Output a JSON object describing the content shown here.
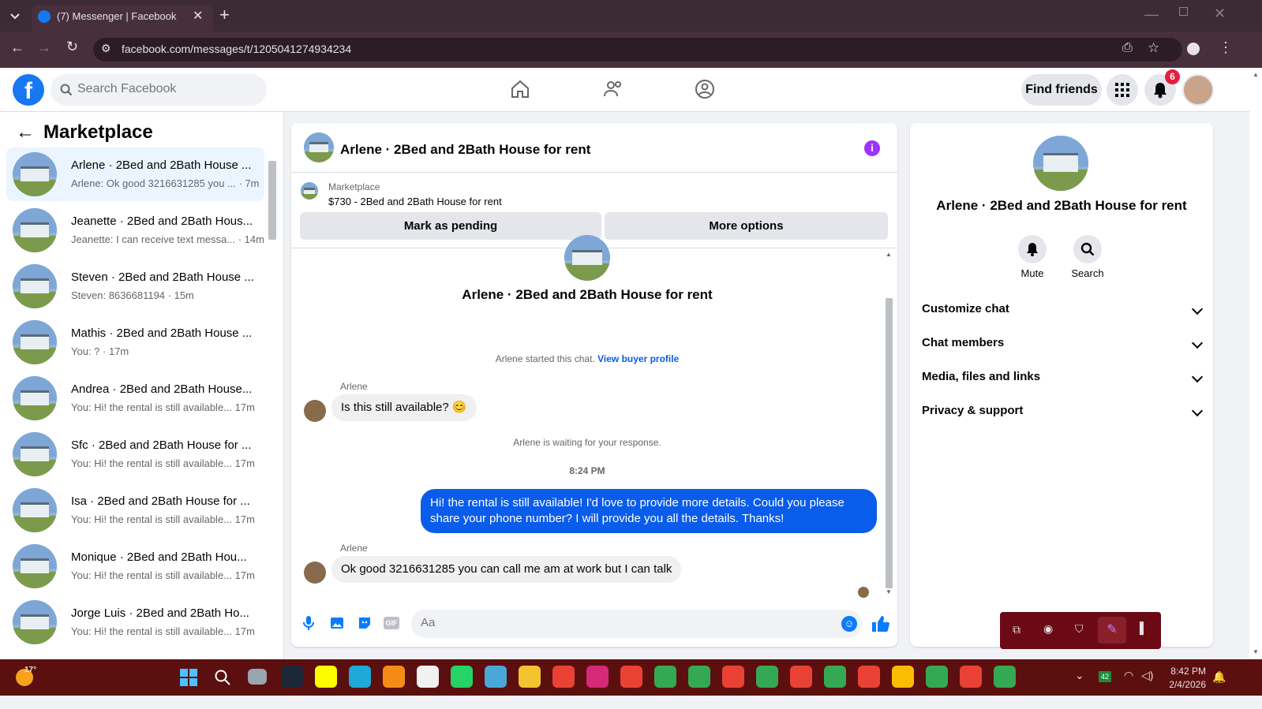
{
  "browser": {
    "tab_title": "(7) Messenger | Facebook",
    "url": "facebook.com/messages/t/1205041274934234"
  },
  "header": {
    "search_placeholder": "Search Facebook",
    "find_friends": "Find friends",
    "notification_count": "6"
  },
  "sidebar": {
    "title": "Marketplace",
    "conversations": [
      {
        "title": "Arlene · 2Bed and 2Bath House ...",
        "preview": "Arlene: Ok good 3216631285 you ...",
        "time": "· 7m"
      },
      {
        "title": "Jeanette · 2Bed and 2Bath Hous...",
        "preview": "Jeanette: I can receive text messa...",
        "time": "· 14m"
      },
      {
        "title": "Steven · 2Bed and 2Bath House ...",
        "preview": "Steven: 8636681194",
        "time": "· 15m"
      },
      {
        "title": "Mathis · 2Bed and 2Bath House ...",
        "preview": "You: ?",
        "time": "· 17m"
      },
      {
        "title": "Andrea · 2Bed and 2Bath House...",
        "preview": "You: Hi! the rental is still available...",
        "time": "17m"
      },
      {
        "title": "Sfc · 2Bed and 2Bath House for ...",
        "preview": "You: Hi! the rental is still available...",
        "time": "17m"
      },
      {
        "title": "Isa · 2Bed and 2Bath House for ...",
        "preview": "You: Hi! the rental is still available...",
        "time": "17m"
      },
      {
        "title": "Monique · 2Bed and 2Bath Hou...",
        "preview": "You: Hi! the rental is still available...",
        "time": "17m"
      },
      {
        "title": "Jorge Luis · 2Bed and 2Bath Ho...",
        "preview": "You: Hi! the rental is still available...",
        "time": "17m"
      }
    ]
  },
  "chat": {
    "header_title": "Arlene · 2Bed and 2Bath House for rent",
    "listing_source": "Marketplace",
    "listing_title": "$730 - 2Bed and 2Bath House for rent",
    "mark_pending": "Mark as pending",
    "more_options": "More options",
    "intro_title": "Arlene · 2Bed and 2Bath House for rent",
    "started_text": "Arlene started this chat.",
    "view_profile": "View buyer profile",
    "sender_1": "Arlene",
    "message_1": "Is this still available? 😊",
    "waiting_text": "Arlene is waiting for your response.",
    "timestamp": "8:24 PM",
    "message_out": "Hi! the rental is still available! I'd love to provide more details. Could you please share your phone number? I will provide you all the details. Thanks!",
    "sender_2": "Arlene",
    "message_2": "Ok good   3216631285 you can call me am at work but I can talk",
    "composer_placeholder": "Aa"
  },
  "details": {
    "title": "Arlene · 2Bed and 2Bath House for rent",
    "mute": "Mute",
    "search": "Search",
    "sections": [
      "Customize chat",
      "Chat members",
      "Media, files and links",
      "Privacy & support"
    ]
  },
  "taskbar": {
    "weather": "17°",
    "time": "8:42 PM",
    "date": "2/4/2026",
    "tray_badge": "42"
  }
}
